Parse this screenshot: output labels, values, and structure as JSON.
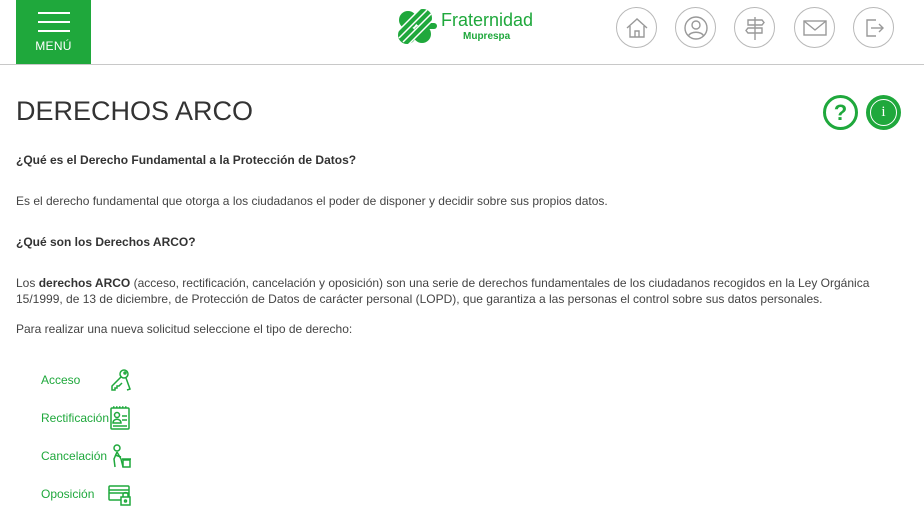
{
  "header": {
    "menu_label": "MENÚ",
    "logo_text": "Fraternidad",
    "logo_sub": "Muprespa",
    "nav_icons": [
      "home-icon",
      "user-icon",
      "signpost-icon",
      "mail-icon",
      "logout-icon"
    ]
  },
  "main": {
    "title": "DERECHOS ARCO",
    "help_icon_glyph": "?",
    "info_icon_glyph": "i",
    "q1": "¿Qué es el Derecho Fundamental a la Protección de Datos?",
    "a1": "Es el derecho fundamental que otorga a los ciudadanos el poder de disponer y decidir sobre sus propios datos.",
    "q2": "¿Qué son los Derechos ARCO?",
    "a2_prefix": "Los ",
    "a2_bold": "derechos ARCO",
    "a2_rest": " (acceso, rectificación, cancelación y oposición) son una serie de derechos fundamentales de los ciudadanos recogidos en la Ley Orgánica 15/1999, de 13 de diciembre, de Protección de Datos de carácter personal (LOPD), que garantiza a las personas el control sobre sus datos personales.",
    "instruction": "Para realizar una nueva solicitud seleccione el tipo de derecho:",
    "rights": [
      {
        "label": "Acceso",
        "icon": "keys-icon"
      },
      {
        "label": "Rectificación",
        "icon": "id-card-icon"
      },
      {
        "label": "Cancelación",
        "icon": "person-bin-icon"
      },
      {
        "label": "Oposición",
        "icon": "card-lock-icon"
      }
    ]
  },
  "colors": {
    "brand_green": "#1fa83c",
    "text": "#444444",
    "border": "#c8c8c8"
  }
}
